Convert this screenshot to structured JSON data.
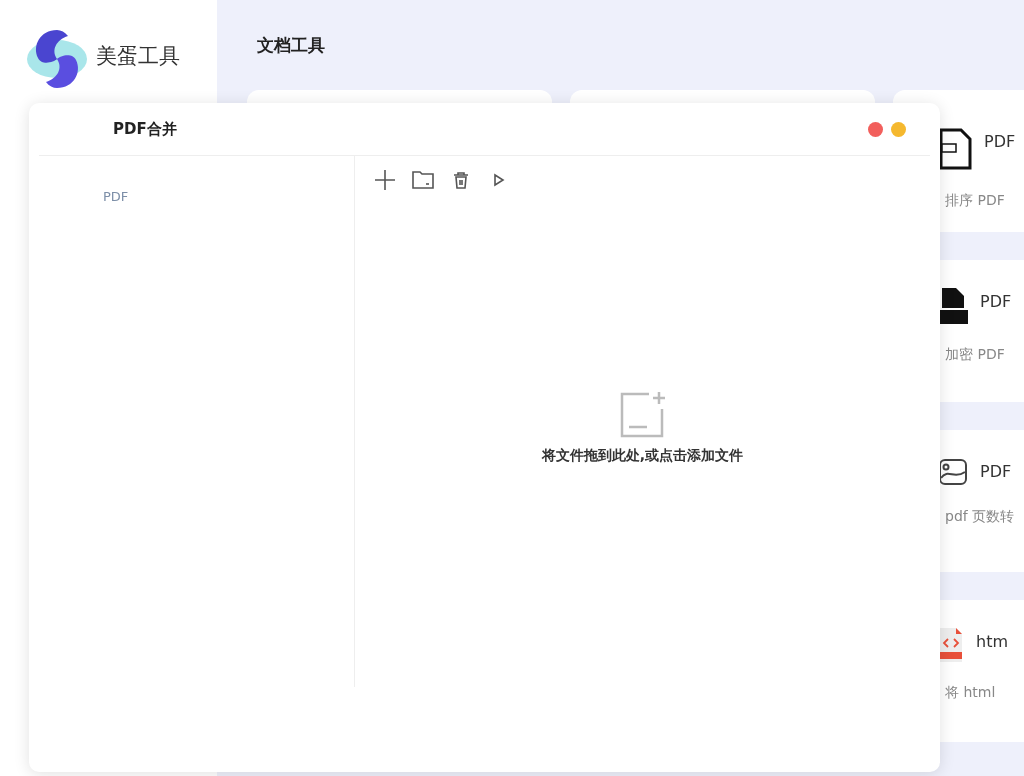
{
  "app": {
    "name": "美蛋工具"
  },
  "header": {
    "title": "文档工具"
  },
  "tool_cards": [
    {
      "kind": "file",
      "title": "PDF",
      "description": "排序 PDF"
    },
    {
      "kind": "solid",
      "title": "PDF",
      "description": "加密 PDF"
    },
    {
      "kind": "image",
      "title": "PDF",
      "description": "pdf 页数转"
    },
    {
      "kind": "code",
      "title": "htm",
      "description": "将 html"
    }
  ],
  "dialog": {
    "title": "PDF合并",
    "list_items": [
      {
        "label": "PDF",
        "selected": false
      }
    ],
    "toolbar": [
      {
        "kind": "add"
      },
      {
        "kind": "folder"
      },
      {
        "kind": "delete"
      },
      {
        "kind": "run"
      }
    ],
    "drop_hint": "将文件拖到此处,或点击添加文件"
  }
}
